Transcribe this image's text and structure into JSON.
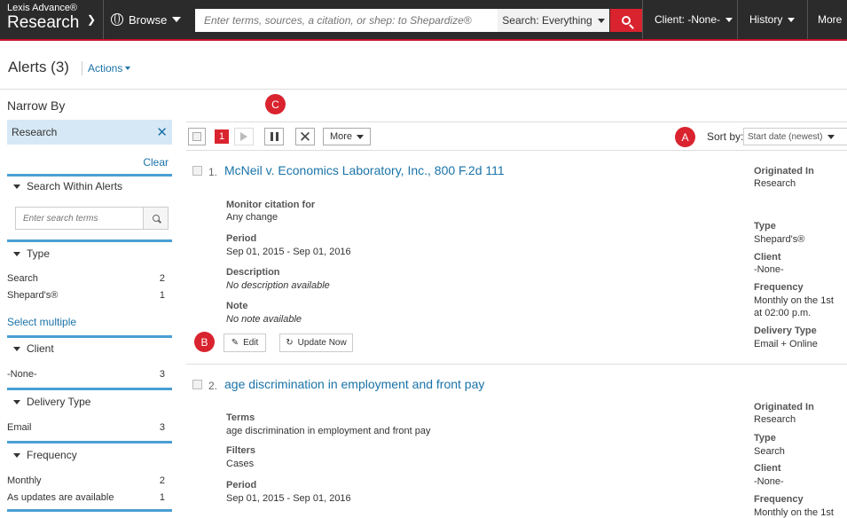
{
  "topbar": {
    "brand_small": "Lexis Advance®",
    "brand_big": "Research",
    "browse_label": "Browse",
    "search_placeholder": "Enter terms, sources, a citation, or shep: to Shepardize®",
    "search_scope": "Search: Everything",
    "client_label": "Client: -None-",
    "history_label": "History",
    "more_label": "More"
  },
  "page": {
    "title": "Alerts (3)",
    "actions_label": "Actions"
  },
  "sidebar": {
    "heading": "Narrow By",
    "active_filter": "Research",
    "clear_label": "Clear",
    "search_section": {
      "label": "Search Within Alerts",
      "placeholder": "Enter search terms"
    },
    "type_section": {
      "label": "Type",
      "items": [
        {
          "label": "Search",
          "count": "2"
        },
        {
          "label": "Shepard's®",
          "count": "1"
        }
      ],
      "select_multiple": "Select multiple"
    },
    "client_section": {
      "label": "Client",
      "items": [
        {
          "label": "-None-",
          "count": "3"
        }
      ]
    },
    "delivery_section": {
      "label": "Delivery Type",
      "items": [
        {
          "label": "Email",
          "count": "3"
        }
      ]
    },
    "frequency_section": {
      "label": "Frequency",
      "items": [
        {
          "label": "Monthly",
          "count": "2"
        },
        {
          "label": "As updates are available",
          "count": "1"
        }
      ]
    }
  },
  "markers": {
    "a": "A",
    "b": "B",
    "c": "C"
  },
  "toolbar": {
    "selected_count": "1",
    "more_label": "More",
    "sort_label": "Sort by:",
    "sort_value": "Start date (newest)"
  },
  "results": [
    {
      "number": "1.",
      "title": "McNeil v. Economics Laboratory, Inc., 800 F.2d 111",
      "fields": {
        "monitor_label": "Monitor citation for",
        "monitor_value": "Any change",
        "period_label": "Period",
        "period_value": "Sep 01, 2015 - Sep 01, 2016",
        "description_label": "Description",
        "description_value": "No description available",
        "note_label": "Note",
        "note_value": "No note available"
      },
      "meta": {
        "originated_label": "Originated In",
        "originated_value": "Research",
        "type_label": "Type",
        "type_value": "Shepard's®",
        "client_label": "Client",
        "client_value": "-None-",
        "frequency_label": "Frequency",
        "frequency_value_1": "Monthly on the 1st",
        "frequency_value_2": "at 02:00 p.m.",
        "delivery_label": "Delivery Type",
        "delivery_value": "Email + Online"
      },
      "edit_label": "Edit",
      "update_label": "Update Now"
    },
    {
      "number": "2.",
      "title": "age discrimination in employment and front pay",
      "fields": {
        "terms_label": "Terms",
        "terms_value": "age discrimination in employment and front pay",
        "filters_label": "Filters",
        "filters_value": "Cases",
        "period_label": "Period",
        "period_value": "Sep 01, 2015 - Sep 01, 2016"
      },
      "meta": {
        "originated_label": "Originated In",
        "originated_value": "Research",
        "type_label": "Type",
        "type_value": "Search",
        "client_label": "Client",
        "client_value": "-None-",
        "frequency_label": "Frequency",
        "frequency_value_1": "Monthly on the 1st"
      }
    }
  ],
  "colors": {
    "topbar": "#2b2b2b",
    "accent_red": "#d9232e",
    "link_blue": "#1a73a8",
    "facet_bar": "#4a9fd4",
    "chip_bg": "#d6e8f5"
  }
}
